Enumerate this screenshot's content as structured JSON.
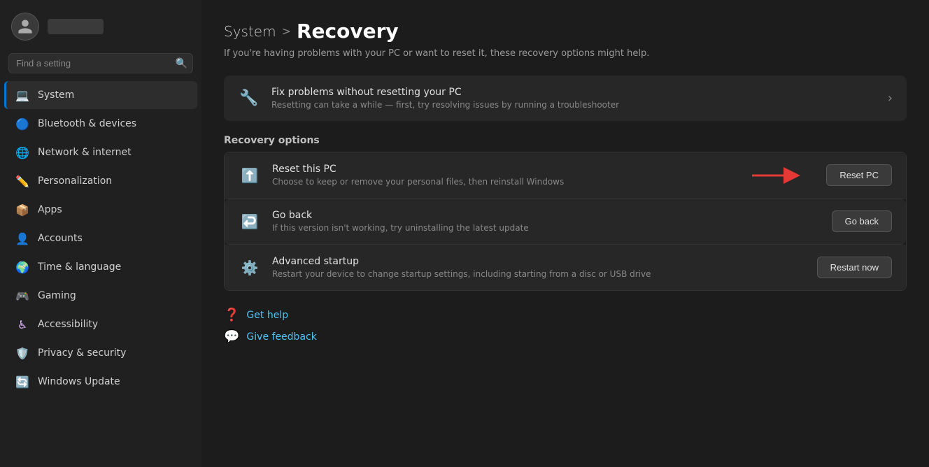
{
  "sidebar": {
    "search_placeholder": "Find a setting",
    "search_icon": "🔍",
    "user": {
      "username_label": ""
    },
    "nav_items": [
      {
        "id": "system",
        "label": "System",
        "icon": "💻",
        "icon_class": "icon-system",
        "active": true
      },
      {
        "id": "bluetooth",
        "label": "Bluetooth & devices",
        "icon": "🔵",
        "icon_class": "icon-bluetooth",
        "active": false
      },
      {
        "id": "network",
        "label": "Network & internet",
        "icon": "🌐",
        "icon_class": "icon-network",
        "active": false
      },
      {
        "id": "personalization",
        "label": "Personalization",
        "icon": "✏️",
        "icon_class": "icon-personalization",
        "active": false
      },
      {
        "id": "apps",
        "label": "Apps",
        "icon": "📦",
        "icon_class": "icon-apps",
        "active": false
      },
      {
        "id": "accounts",
        "label": "Accounts",
        "icon": "👤",
        "icon_class": "icon-accounts",
        "active": false
      },
      {
        "id": "time",
        "label": "Time & language",
        "icon": "🌍",
        "icon_class": "icon-time",
        "active": false
      },
      {
        "id": "gaming",
        "label": "Gaming",
        "icon": "🎮",
        "icon_class": "icon-gaming",
        "active": false
      },
      {
        "id": "accessibility",
        "label": "Accessibility",
        "icon": "♿",
        "icon_class": "icon-accessibility",
        "active": false
      },
      {
        "id": "privacy",
        "label": "Privacy & security",
        "icon": "🛡️",
        "icon_class": "icon-privacy",
        "active": false
      },
      {
        "id": "update",
        "label": "Windows Update",
        "icon": "🔄",
        "icon_class": "icon-update",
        "active": false
      }
    ]
  },
  "main": {
    "breadcrumb": {
      "parent": "System",
      "separator": ">",
      "current": "Recovery"
    },
    "subtitle": "If you're having problems with your PC or want to reset it, these recovery options might help.",
    "fix_card": {
      "title": "Fix problems without resetting your PC",
      "desc": "Resetting can take a while — first, try resolving issues by running a troubleshooter"
    },
    "section_label": "Recovery options",
    "recovery_items": [
      {
        "id": "reset-pc",
        "title": "Reset this PC",
        "desc": "Choose to keep or remove your personal files, then reinstall Windows",
        "button_label": "Reset PC",
        "has_arrow": true
      },
      {
        "id": "go-back",
        "title": "Go back",
        "desc": "If this version isn't working, try uninstalling the latest update",
        "button_label": "Go back",
        "has_arrow": false
      },
      {
        "id": "advanced-startup",
        "title": "Advanced startup",
        "desc": "Restart your device to change startup settings, including starting from a disc or USB drive",
        "button_label": "Restart now",
        "has_arrow": false
      }
    ],
    "help_links": [
      {
        "id": "get-help",
        "label": "Get help"
      },
      {
        "id": "give-feedback",
        "label": "Give feedback"
      }
    ]
  }
}
